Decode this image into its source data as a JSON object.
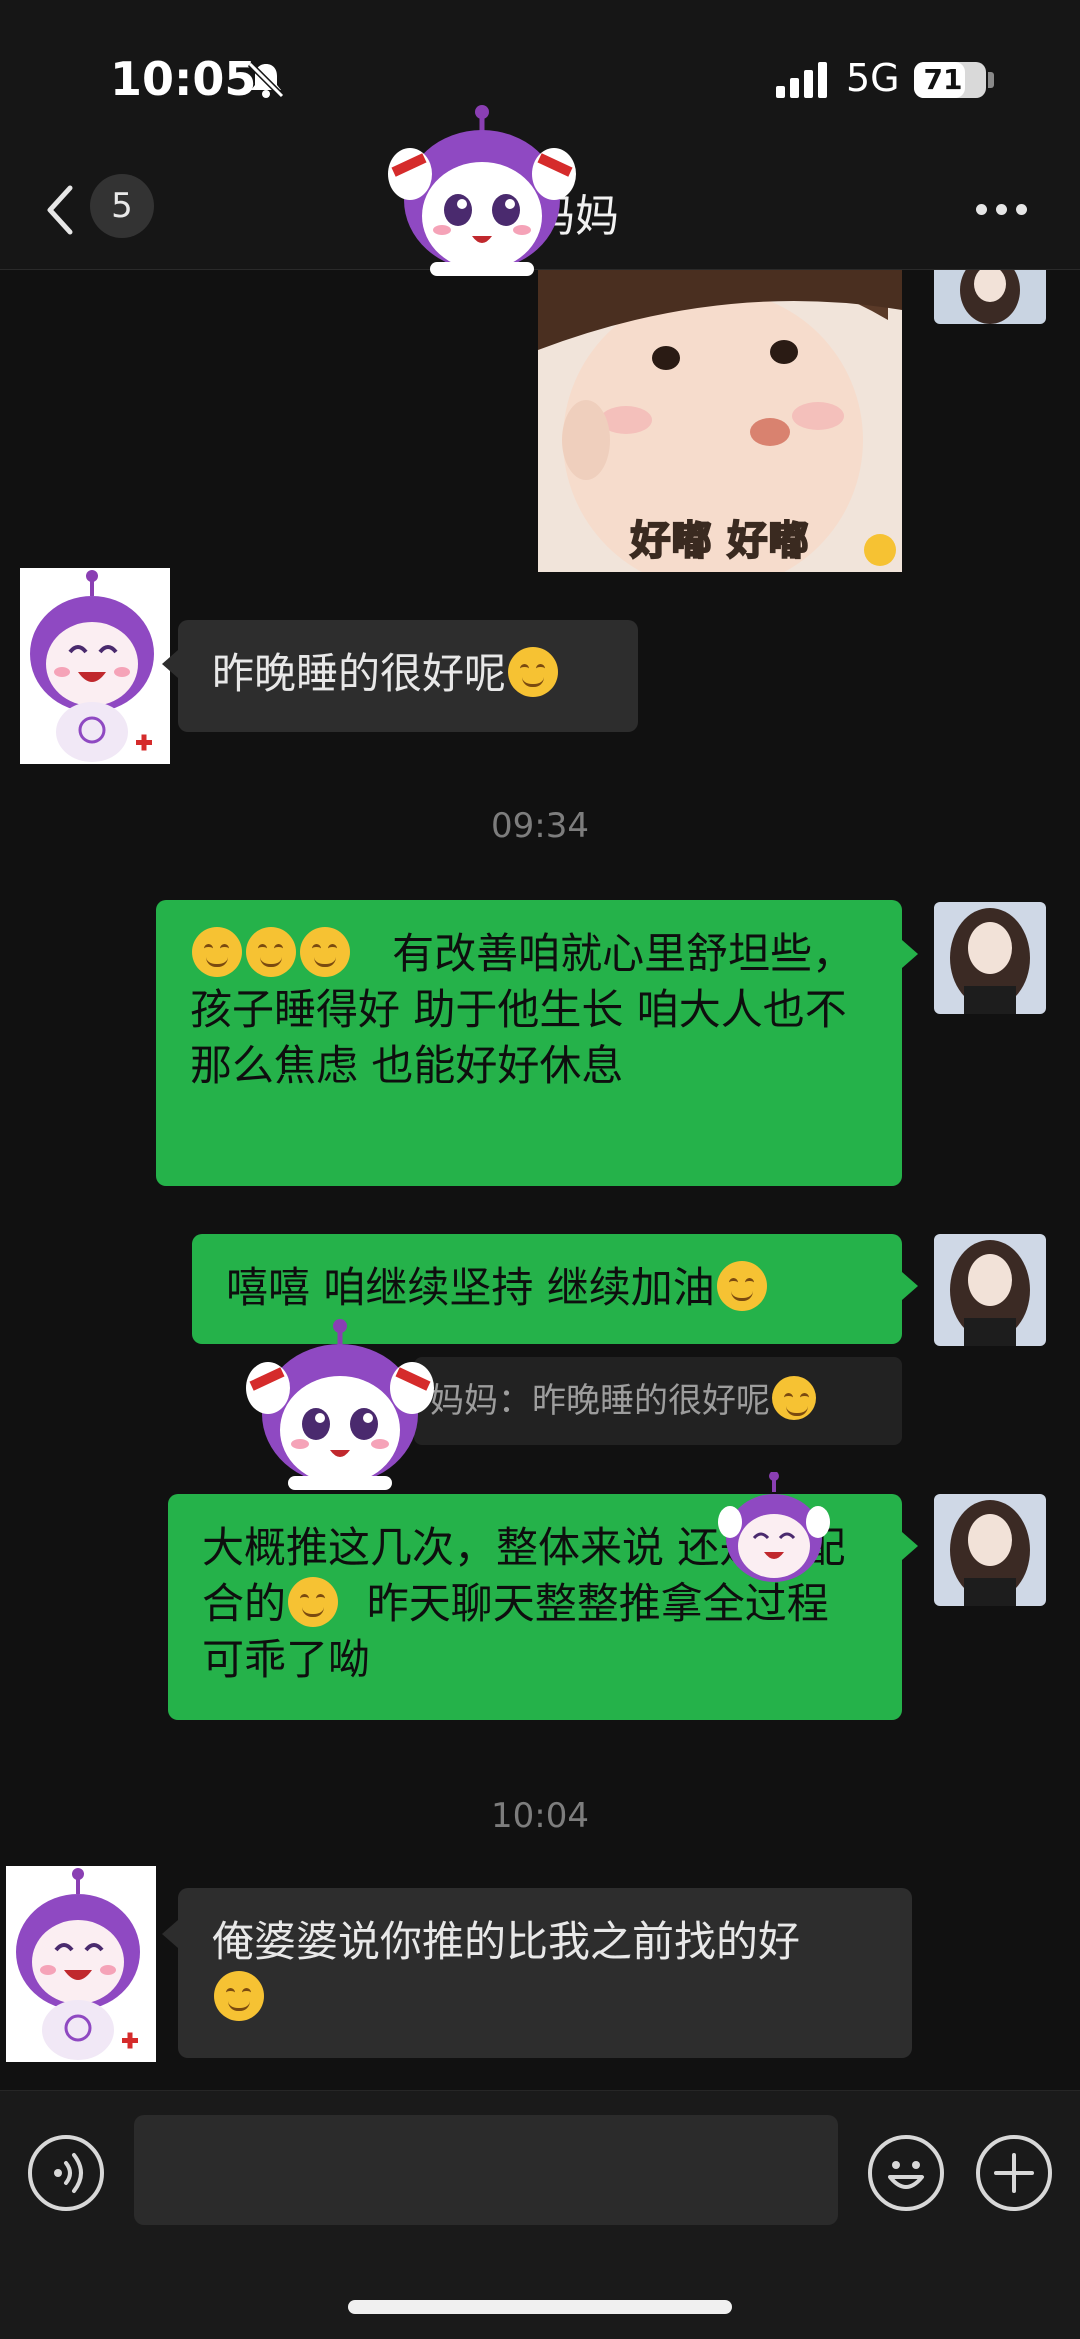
{
  "status_bar": {
    "time": "10:05",
    "network": "5G",
    "battery": "71",
    "battery_level": 0.71,
    "icons": [
      "bell-off-icon",
      "signal-icon",
      "battery-icon"
    ]
  },
  "header": {
    "unread_count": "5",
    "title": "妈妈",
    "icons": [
      "chevron-left-icon",
      "more-icon"
    ]
  },
  "colors": {
    "self_bubble": "#25b24a",
    "other_bubble": "#2d2d2d",
    "background": "#111111",
    "timestamp": "#7d7d7d"
  },
  "messages": {
    "photo_caption": "好嘟 好嘟",
    "m1_text": "昨晚睡的很好呢",
    "time_1": "09:34",
    "m2_text": "有改善咱就心里舒坦些，孩子睡得好  助于他生长   咱大人也不那么焦虑   也能好好休息",
    "m3_text": "嘻嘻    咱继续坚持 继续加油",
    "quote_text": "妈妈：昨晚睡的很好呢",
    "m4_text": "大概推这几次，整体来说     还是挺配合的",
    "m4_text_b": "昨天聊天整整推拿全过程   可乖了呦",
    "time_2": "10:04",
    "m5_text": "俺婆婆说你推的比我之前找的好"
  },
  "input_bar": {
    "placeholder": "",
    "icons": [
      "voice-icon",
      "emoji-icon",
      "plus-icon"
    ]
  }
}
